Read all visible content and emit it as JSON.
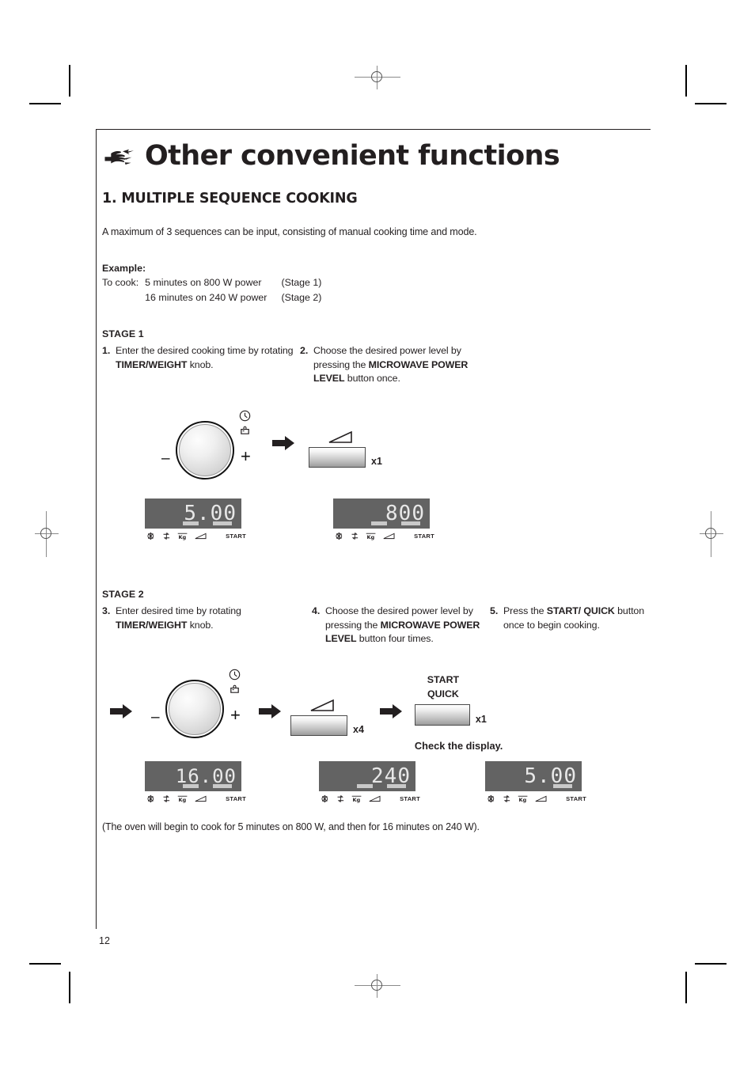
{
  "page": {
    "number": "12",
    "title": "Other convenient functions",
    "title_icon": "pointing-hand-icon",
    "section_title": "1. MULTIPLE SEQUENCE COOKING",
    "intro": "A maximum of 3 sequences can be input, consisting of manual cooking time and mode.",
    "closing_note": "(The oven will begin to cook for 5 minutes on 800 W, and then for 16 minutes on 240 W)."
  },
  "example": {
    "label": "Example:",
    "lead": "To cook:",
    "rows": [
      {
        "value": "5 minutes on 800 W power",
        "stage": "(Stage 1)"
      },
      {
        "value": "16 minutes on 240 W power",
        "stage": "(Stage 2)"
      }
    ]
  },
  "stage1": {
    "label": "STAGE 1",
    "steps": [
      {
        "num": "1.",
        "text_parts": [
          {
            "t": "Enter the desired cooking time by rotating ",
            "b": false
          },
          {
            "t": "TIMER/WEIGHT",
            "b": true
          },
          {
            "t": " knob.",
            "b": false
          }
        ]
      },
      {
        "num": "2.",
        "text_parts": [
          {
            "t": "Choose the desired power level by pressing the ",
            "b": false
          },
          {
            "t": "MICROWAVE POWER LEVEL",
            "b": true
          },
          {
            "t": " button once.",
            "b": false
          }
        ]
      }
    ],
    "knob": {
      "minus": "–",
      "plus": "+",
      "icons": [
        "clock-icon",
        "weight-icon"
      ]
    },
    "power_button": {
      "press_count": "x1",
      "icon": "power-level-triangle-icon"
    },
    "display_left": {
      "digits": "5.00",
      "indicators": [
        "defrost-icon",
        "auto-cook-icon",
        "kg-icon",
        "power-level-icon"
      ],
      "start": "START"
    },
    "display_right": {
      "digits": "800",
      "indicators": [
        "defrost-icon",
        "auto-cook-icon",
        "kg-icon",
        "power-level-icon"
      ],
      "start": "START"
    }
  },
  "stage2": {
    "label": "STAGE 2",
    "steps": [
      {
        "num": "3.",
        "text_parts": [
          {
            "t": "Enter desired time by rotating ",
            "b": false
          },
          {
            "t": "TIMER/WEIGHT",
            "b": true
          },
          {
            "t": " knob.",
            "b": false
          }
        ]
      },
      {
        "num": "4.",
        "text_parts": [
          {
            "t": "Choose the desired power level by pressing the ",
            "b": false
          },
          {
            "t": "MICROWAVE POWER LEVEL",
            "b": true
          },
          {
            "t": " button four times.",
            "b": false
          }
        ]
      },
      {
        "num": "5.",
        "text_parts": [
          {
            "t": "Press the ",
            "b": false
          },
          {
            "t": "START/ QUICK",
            "b": true
          },
          {
            "t": " button once to begin cooking.",
            "b": false
          }
        ]
      }
    ],
    "knob": {
      "minus": "–",
      "plus": "+",
      "icons": [
        "clock-icon",
        "weight-icon"
      ]
    },
    "power_button": {
      "press_count": "x4",
      "icon": "power-level-triangle-icon"
    },
    "start_button": {
      "line1": "START",
      "line2": "QUICK",
      "press_count": "x1"
    },
    "check_display": "Check the display.",
    "display_1": {
      "digits": "16.00",
      "indicators": [
        "defrost-icon",
        "auto-cook-icon",
        "kg-icon",
        "power-level-icon"
      ],
      "start": "START"
    },
    "display_2": {
      "digits": "240",
      "indicators": [
        "defrost-icon",
        "auto-cook-icon",
        "kg-icon",
        "power-level-icon"
      ],
      "start": "START"
    },
    "display_3": {
      "digits": "5.00",
      "indicators": [
        "defrost-icon",
        "auto-cook-icon",
        "kg-icon",
        "power-level-icon"
      ],
      "start": "START"
    }
  },
  "colors": {
    "text": "#231f20",
    "lcd_background": "#636363",
    "lcd_digit": "#e8e8e8",
    "rule": "#231f20"
  }
}
